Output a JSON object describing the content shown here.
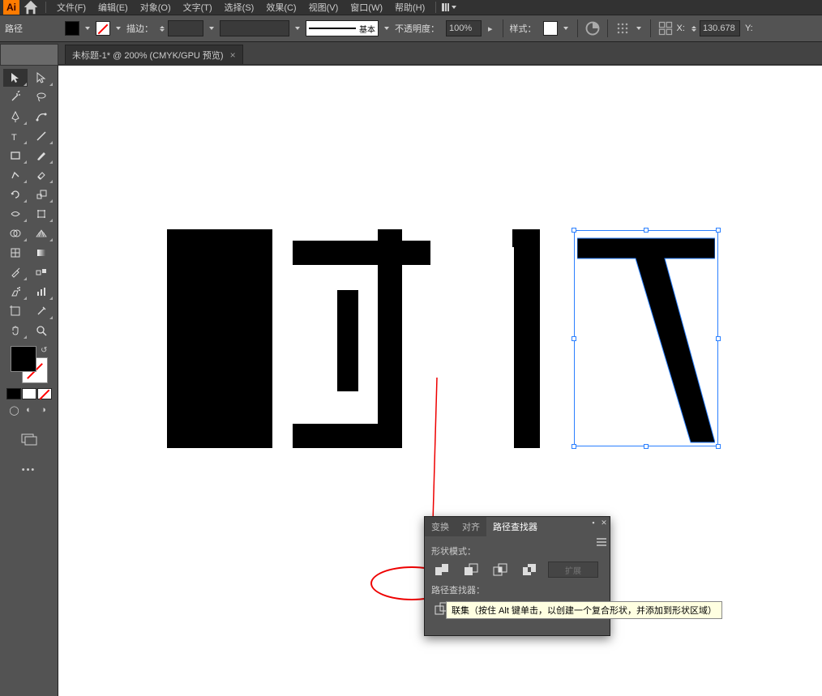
{
  "app": {
    "logo": "Ai"
  },
  "menubar": {
    "items": [
      "文件(F)",
      "编辑(E)",
      "对象(O)",
      "文字(T)",
      "选择(S)",
      "效果(C)",
      "视图(V)",
      "窗口(W)",
      "帮助(H)"
    ]
  },
  "controlbar": {
    "obj_label": "路径",
    "stroke_label": "描边：",
    "stroke_preview_label": "基本",
    "opacity_label": "不透明度：",
    "opacity_value": "100%",
    "style_label": "样式：",
    "x_label": "X:",
    "x_value": "130.678",
    "y_label": "Y:"
  },
  "document": {
    "tab_title": "未标题-1* @ 200% (CMYK/GPU 预览)"
  },
  "pathfinder": {
    "tabs": [
      "变换",
      "对齐",
      "路径查找器"
    ],
    "active_tab": 2,
    "shape_modes_label": "形状模式：",
    "pathfinders_label": "路径查找器：",
    "expand_label": "扩展",
    "tooltip": "联集（按住 Alt 键单击，以创建一个复合形状，并添加到形状区域）"
  }
}
